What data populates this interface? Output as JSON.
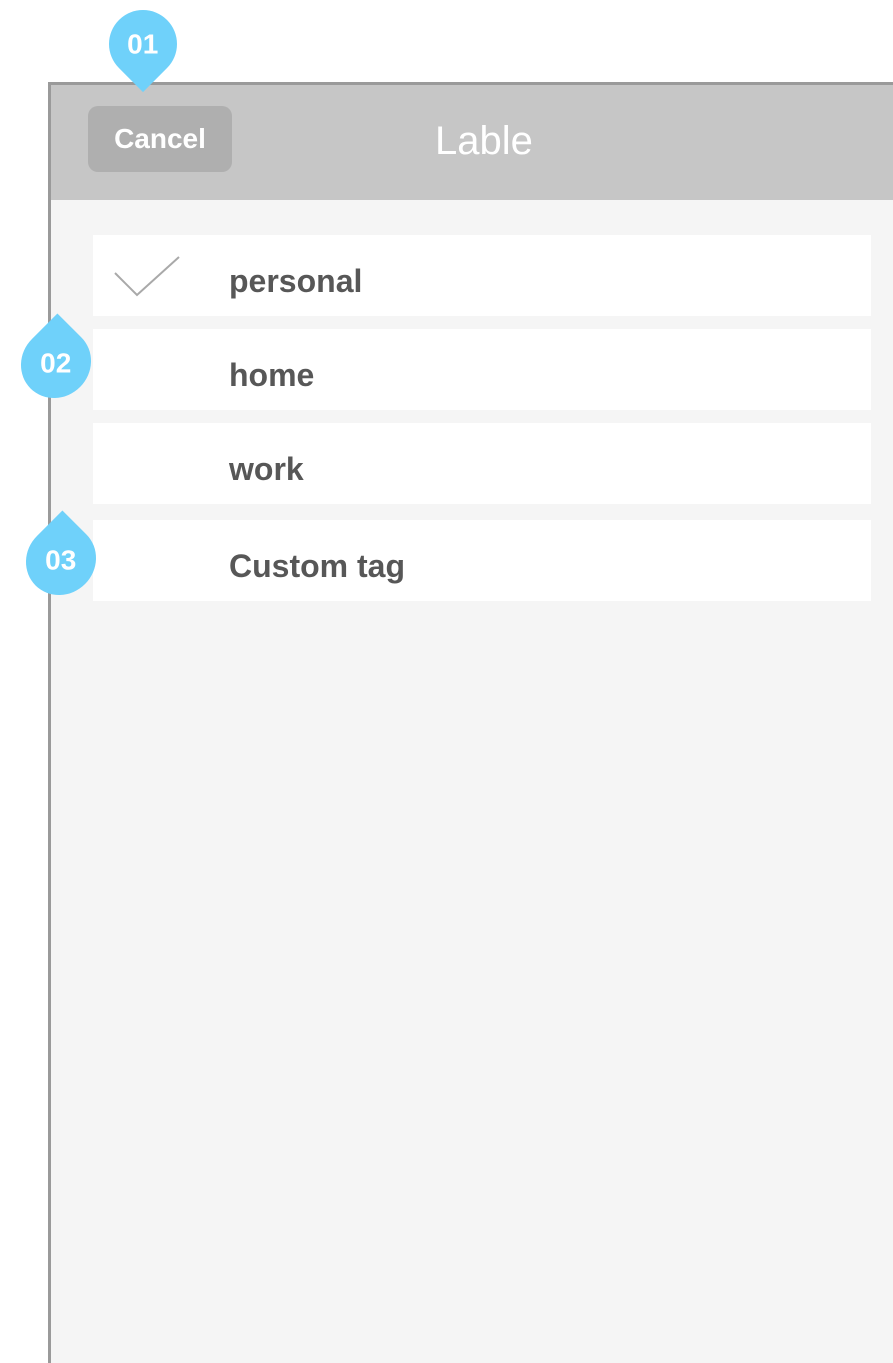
{
  "annotations": {
    "marker_1": "01",
    "marker_2": "02",
    "marker_3": "03"
  },
  "navbar": {
    "cancel_label": "Cancel",
    "title": "Lable"
  },
  "labels": {
    "items": [
      {
        "label": "personal",
        "selected": true
      },
      {
        "label": "home",
        "selected": false
      },
      {
        "label": "work",
        "selected": false
      },
      {
        "label": "Custom tag",
        "selected": false
      }
    ]
  },
  "icons": {
    "check": "check-icon"
  },
  "colors": {
    "navbar_bg": "#c6c6c6",
    "button_bg": "#afafaf",
    "marker": "#6fd1fa",
    "text": "#575757",
    "background": "#f5f5f5"
  }
}
